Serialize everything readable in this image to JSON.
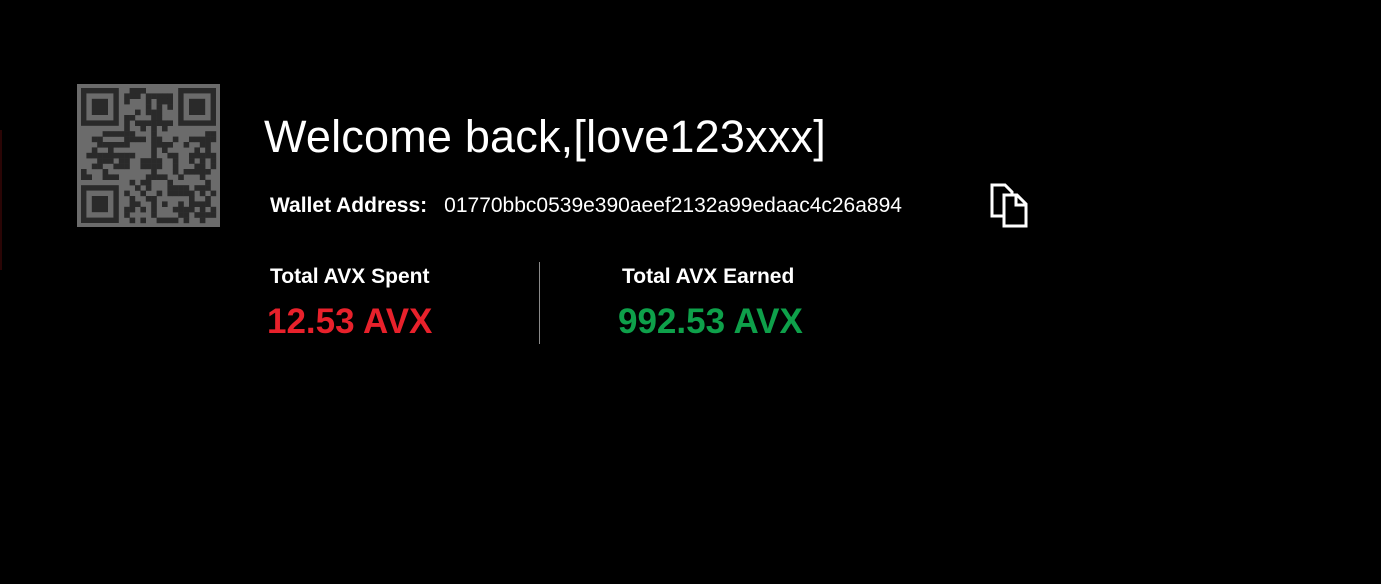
{
  "header": {
    "welcome_text": "Welcome back,[love123xxx]"
  },
  "wallet": {
    "label": "Wallet Address:",
    "address": "01770bbc0539e390aeef2132a99edaac4c26a894",
    "qr_icon": "qr-code-icon",
    "copy_icon": "copy-icon"
  },
  "stats": {
    "spent": {
      "label": "Total AVX Spent",
      "value": "12.53 AVX",
      "color": "#e8212b"
    },
    "earned": {
      "label": "Total AVX Earned",
      "value": "992.53 AVX",
      "color": "#0ea04a"
    }
  },
  "colors": {
    "background": "#000000",
    "text": "#ffffff",
    "qr": "#6b6b6b",
    "divider": "#8a8a8a"
  }
}
